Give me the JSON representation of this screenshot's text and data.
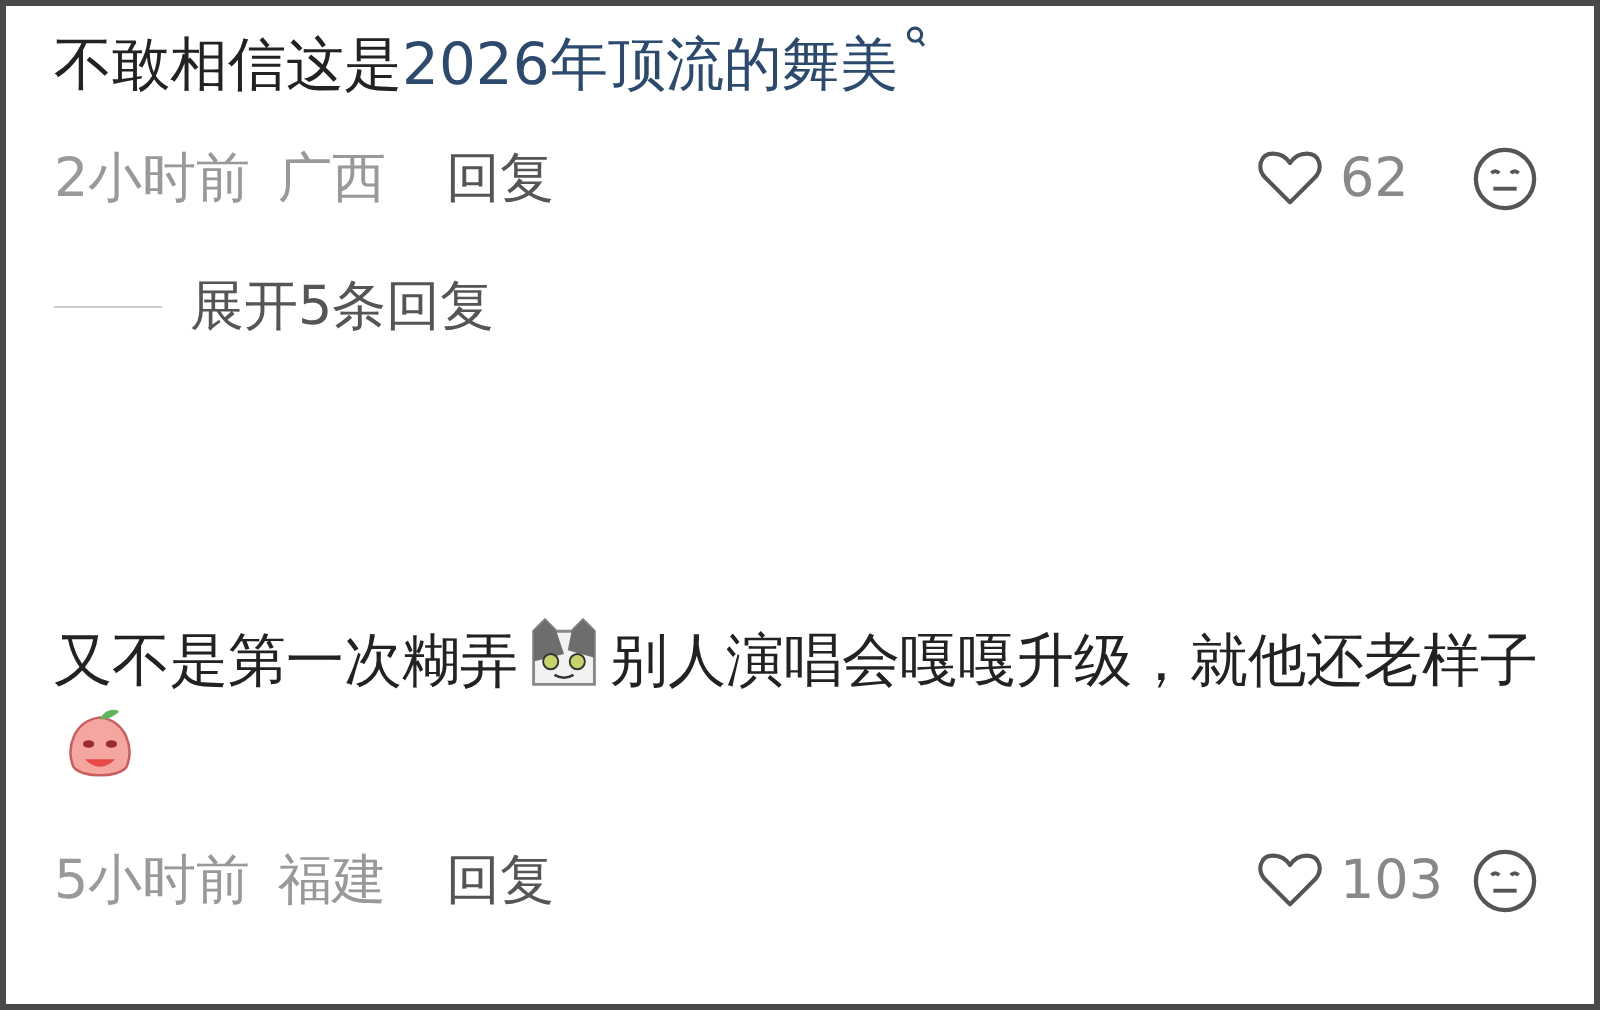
{
  "comments": [
    {
      "segments": [
        {
          "kind": "text",
          "text": "不敢相信这是"
        },
        {
          "kind": "link",
          "text": "2026年顶流的舞美"
        }
      ],
      "time": "2小时前",
      "region": "广西",
      "reply": "回复",
      "likes": "62",
      "expand": "展开5条回复"
    },
    {
      "segments": [
        {
          "kind": "text",
          "text": "又不是第一次糊弄"
        },
        {
          "kind": "cat"
        },
        {
          "kind": "text",
          "text": "别人演唱会嘎嘎升级，就他还老样子"
        },
        {
          "kind": "peach"
        }
      ],
      "time": "5小时前",
      "region": "福建",
      "reply": "回复",
      "likes": "103"
    }
  ]
}
